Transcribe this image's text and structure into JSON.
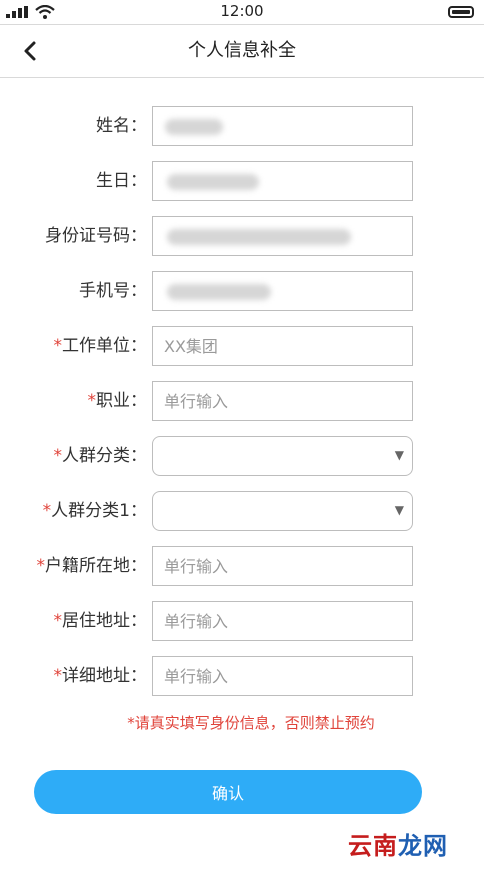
{
  "status_bar": {
    "time": "12:00"
  },
  "nav": {
    "title": "个人信息补全"
  },
  "form": {
    "fields": [
      {
        "required": "",
        "label": "姓名：",
        "value": "",
        "placeholder": ""
      },
      {
        "required": "",
        "label": "生日：",
        "value": "",
        "placeholder": ""
      },
      {
        "required": "",
        "label": "身份证号码：",
        "value": "",
        "placeholder": ""
      },
      {
        "required": "",
        "label": "手机号：",
        "value": "",
        "placeholder": ""
      },
      {
        "required": "*",
        "label": "工作单位：",
        "value": "",
        "placeholder": "XX集团"
      },
      {
        "required": "*",
        "label": "职业：",
        "value": "",
        "placeholder": "单行输入"
      },
      {
        "required": "*",
        "label": "人群分类：",
        "value": "",
        "placeholder": ""
      },
      {
        "required": "*",
        "label": "人群分类1：",
        "value": "",
        "placeholder": ""
      },
      {
        "required": "*",
        "label": "户籍所在地：",
        "value": "",
        "placeholder": "单行输入"
      },
      {
        "required": "*",
        "label": "居住地址：",
        "value": "",
        "placeholder": "单行输入"
      },
      {
        "required": "*",
        "label": "详细地址：",
        "value": "",
        "placeholder": "单行输入"
      }
    ],
    "dropdown_caret": "▼"
  },
  "notice": "*请真实填写身份信息，否则禁止预约",
  "confirm_label": "确认",
  "watermark": {
    "part1": "云南",
    "part2": "龙网"
  },
  "colors": {
    "accent": "#2eacf7",
    "required": "#e0443b"
  }
}
